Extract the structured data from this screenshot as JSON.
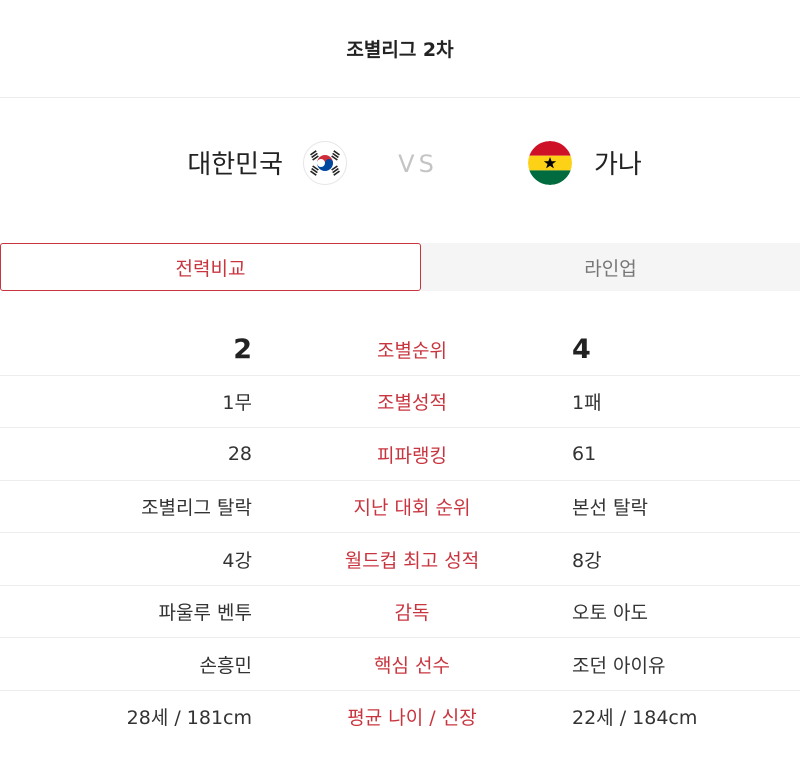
{
  "header": {
    "title": "조별리그 2차"
  },
  "match": {
    "home": {
      "name": "대한민국",
      "flag_icon": "south-korea-flag-icon"
    },
    "vs_label": "VS",
    "away": {
      "name": "가나",
      "flag_icon": "ghana-flag-icon"
    }
  },
  "tabs": [
    {
      "label": "전력비교",
      "active": true
    },
    {
      "label": "라인업",
      "active": false
    }
  ],
  "stats": [
    {
      "label": "조별순위",
      "home": "2",
      "away": "4"
    },
    {
      "label": "조별성적",
      "home": "1무",
      "away": "1패"
    },
    {
      "label": "피파랭킹",
      "home": "28",
      "away": "61"
    },
    {
      "label": "지난 대회 순위",
      "home": "조별리그 탈락",
      "away": "본선 탈락"
    },
    {
      "label": "월드컵 최고 성적",
      "home": "4강",
      "away": "8강"
    },
    {
      "label": "감독",
      "home": "파울루 벤투",
      "away": "오토 아도"
    },
    {
      "label": "핵심 선수",
      "home": "손흥민",
      "away": "조던 아이유"
    },
    {
      "label": "평균 나이 / 신장",
      "home": "28세 / 181cm",
      "away": "22세 / 184cm"
    }
  ],
  "colors": {
    "accent": "#c8353f",
    "inactive_tab_bg": "#f5f5f5"
  }
}
